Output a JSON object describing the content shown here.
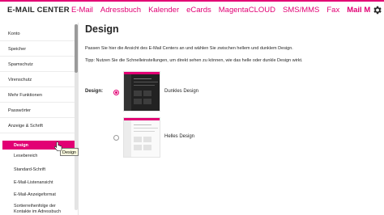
{
  "app": {
    "brand": "E-MAIL CENTER",
    "accent_color": "#e20074",
    "settings_icon": "gear-icon"
  },
  "nav": {
    "items": [
      "E-Mail",
      "Adressbuch",
      "Kalender",
      "eCards",
      "MagentaCLOUD",
      "SMS/MMS",
      "Fax",
      "Mail M"
    ],
    "active_item": "Mail M"
  },
  "sidebar": {
    "items": [
      "Konto",
      "Speicher",
      "Spamschutz",
      "Virenschutz",
      "Mehr Funktionen",
      "Passwörter",
      "Anzeige & Schrift"
    ],
    "subitems": [
      "Design",
      "Lesebereich",
      "Standard-Schrift",
      "E-Mail-Listenansicht",
      "E-Mail-Anzeigeformat",
      "Sortierreihenfolge der",
      "Kontakte im Adressbuch"
    ],
    "active_subitem": "Design",
    "tooltip": "Design"
  },
  "main": {
    "title": "Design",
    "intro": "Passen Sie hier die Ansicht des E-Mail Centers an und wählen Sie zwischen hellem und dunklem Design.",
    "tip": "Tipp: Nutzen Sie die Schnelleinstellungen, um direkt sehen zu können, wie das helle oder dunkle Design wirkt.",
    "design_label": "Design:",
    "options": [
      {
        "label": "Dunkles Design",
        "selected": true
      },
      {
        "label": "Helles Design",
        "selected": false
      }
    ]
  }
}
